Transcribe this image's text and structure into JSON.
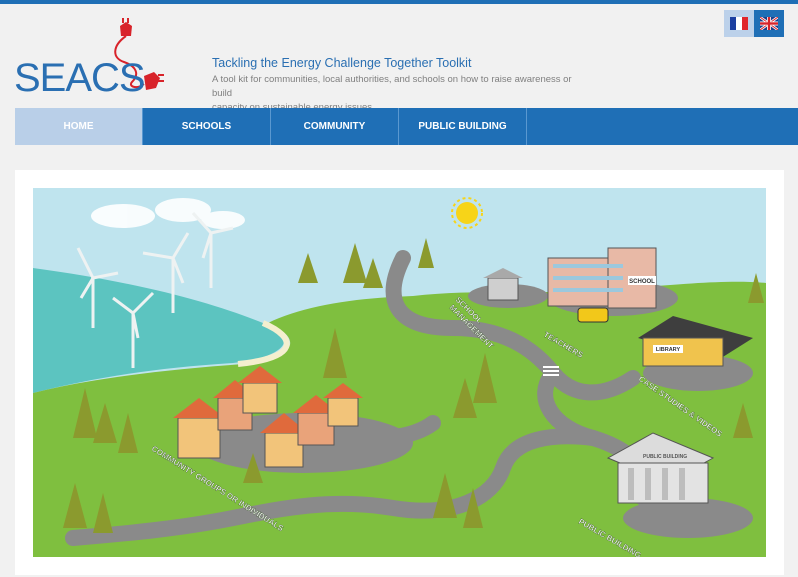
{
  "header": {
    "logo_text": "SEACS",
    "title": "Tackling the Energy Challenge Together Toolkit",
    "subtitle_line1": "A tool kit for communities, local authorities, and schools on how to raise awareness or build",
    "subtitle_line2": "capacity on sustainable energy issues."
  },
  "languages": [
    {
      "code": "fr",
      "icon": "french-flag-icon",
      "active": true
    },
    {
      "code": "en",
      "icon": "uk-flag-icon",
      "active": false
    }
  ],
  "nav": {
    "items": [
      {
        "label": "HOME",
        "active": true
      },
      {
        "label": "SCHOOLS",
        "active": false
      },
      {
        "label": "COMMUNITY",
        "active": false
      },
      {
        "label": "PUBLIC BUILDING",
        "active": false
      }
    ]
  },
  "map": {
    "labels": {
      "school_management_1": "SCHOOL",
      "school_management_2": "MANAGEMENT",
      "teachers": "TEACHERS",
      "case_studies": "CASE STUDIES & VIDEOS",
      "community": "COMMUNITY GROUPS OR INDIVIDUALS",
      "public_building": "PUBLIC BUILDING",
      "school_sign": "SCHOOL",
      "library_sign": "LIBRARY",
      "public_building_sign": "PUBLIC BUILDING"
    }
  },
  "colors": {
    "brand_blue": "#1f6fb6",
    "nav_active": "#b9cfe8",
    "grass": "#7fbf3f",
    "sea": "#5cc4c0",
    "road": "#8a8a8a"
  }
}
